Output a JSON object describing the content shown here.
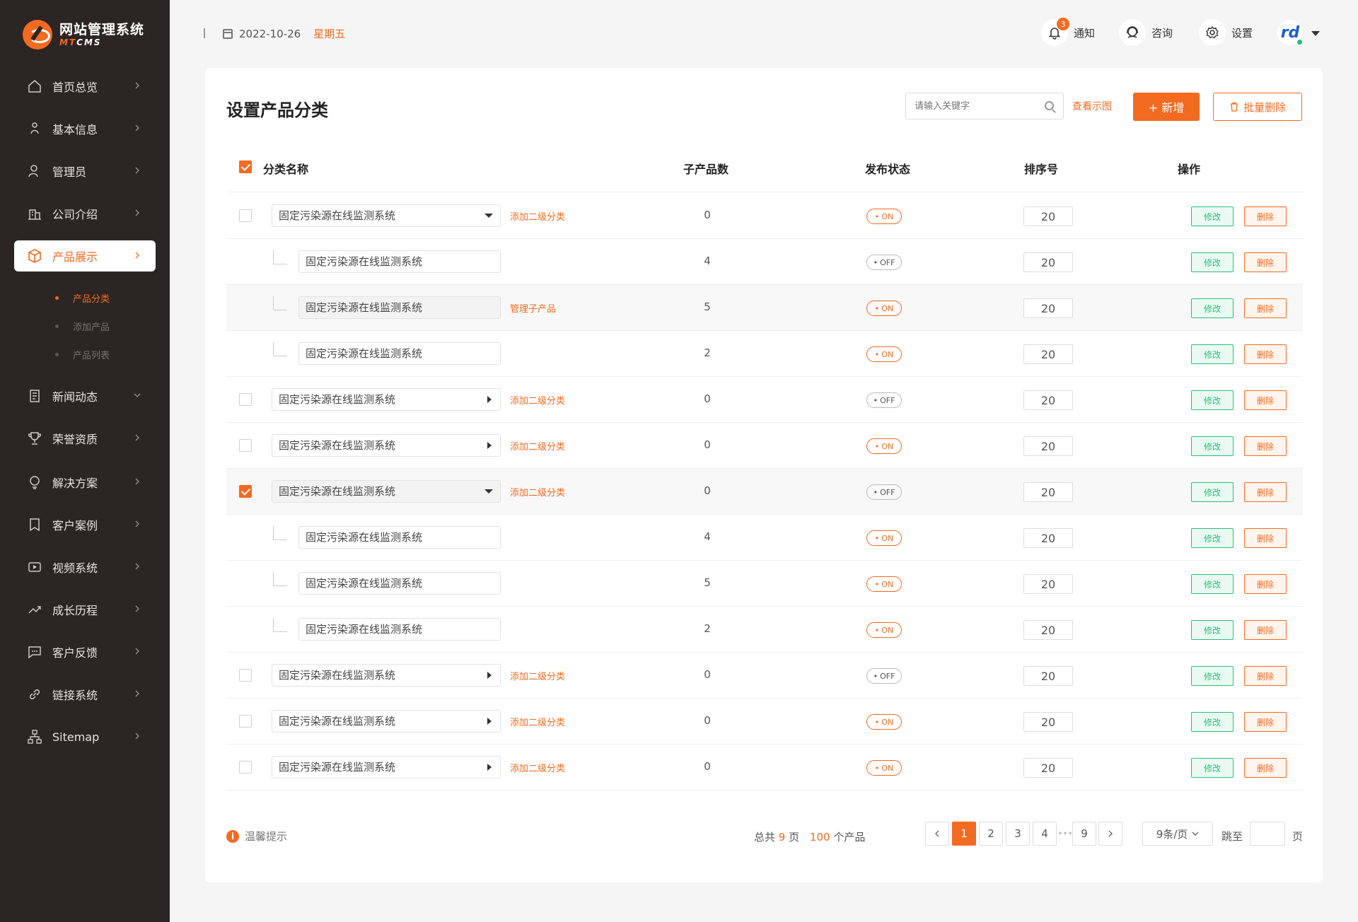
{
  "brand": {
    "title": "网站管理系统",
    "sub_a": "MT",
    "sub_b": "CMS"
  },
  "nav": [
    {
      "label": "首页总览",
      "icon": "home-icon"
    },
    {
      "label": "基本信息",
      "icon": "info-icon"
    },
    {
      "label": "管理员",
      "icon": "admin-icon"
    },
    {
      "label": "公司介绍",
      "icon": "building-icon"
    },
    {
      "label": "产品展示",
      "icon": "box-icon",
      "active": true
    },
    {
      "label": "新闻动态",
      "icon": "news-icon",
      "expanded": true
    },
    {
      "label": "荣誉资质",
      "icon": "trophy-icon"
    },
    {
      "label": "解决方案",
      "icon": "bulb-icon"
    },
    {
      "label": "客户案例",
      "icon": "bookmark-icon"
    },
    {
      "label": "视频系统",
      "icon": "video-icon"
    },
    {
      "label": "成长历程",
      "icon": "trend-icon"
    },
    {
      "label": "客户反馈",
      "icon": "message-icon"
    },
    {
      "label": "链接系统",
      "icon": "link-icon"
    },
    {
      "label": "Sitemap",
      "icon": "sitemap-icon"
    }
  ],
  "subnav": [
    "产品分类",
    "添加产品",
    "产品列表"
  ],
  "header": {
    "date": "2022-10-26",
    "weekday": "星期五",
    "notify_label": "通知",
    "notify_count": "3",
    "consult_label": "咨询",
    "settings_label": "设置",
    "avatar_text": "rd"
  },
  "page": {
    "title": "设置产品分类",
    "search_placeholder": "请输入关键字",
    "view_link": "查看示图",
    "add_label": "+ 新增",
    "bulk_delete_label": "批量删除"
  },
  "table": {
    "columns": [
      "分类名称",
      "子产品数",
      "发布状态",
      "排序号",
      "操作"
    ],
    "edit_label": "修改",
    "delete_label": "删除",
    "rows": [
      {
        "level": 1,
        "name": "固定污染源在线监测系统",
        "arrow": "down",
        "link": "添加二级分类",
        "count": "0",
        "status": "ON",
        "sort": "20",
        "checked": false
      },
      {
        "level": 2,
        "name": "固定污染源在线监测系统",
        "link": "",
        "count": "4",
        "status": "OFF",
        "sort": "20"
      },
      {
        "level": 2,
        "name": "固定污染源在线监测系统",
        "link": "管理子产品",
        "count": "5",
        "status": "ON",
        "sort": "20",
        "shade": true
      },
      {
        "level": 2,
        "name": "固定污染源在线监测系统",
        "link": "",
        "count": "2",
        "status": "ON",
        "sort": "20"
      },
      {
        "level": 1,
        "name": "固定污染源在线监测系统",
        "arrow": "right",
        "link": "添加二级分类",
        "count": "0",
        "status": "OFF",
        "sort": "20",
        "checked": false
      },
      {
        "level": 1,
        "name": "固定污染源在线监测系统",
        "arrow": "right",
        "link": "添加二级分类",
        "count": "0",
        "status": "ON",
        "sort": "20",
        "checked": false
      },
      {
        "level": 1,
        "name": "固定污染源在线监测系统",
        "arrow": "down",
        "link": "添加二级分类",
        "count": "0",
        "status": "OFF",
        "sort": "20",
        "checked": true,
        "shade": true
      },
      {
        "level": 2,
        "name": "固定污染源在线监测系统",
        "link": "",
        "count": "4",
        "status": "ON",
        "sort": "20"
      },
      {
        "level": 2,
        "name": "固定污染源在线监测系统",
        "link": "",
        "count": "5",
        "status": "ON",
        "sort": "20"
      },
      {
        "level": 2,
        "name": "固定污染源在线监测系统",
        "link": "",
        "count": "2",
        "status": "ON",
        "sort": "20"
      },
      {
        "level": 1,
        "name": "固定污染源在线监测系统",
        "arrow": "right",
        "link": "添加二级分类",
        "count": "0",
        "status": "OFF",
        "sort": "20",
        "checked": false
      },
      {
        "level": 1,
        "name": "固定污染源在线监测系统",
        "arrow": "right",
        "link": "添加二级分类",
        "count": "0",
        "status": "ON",
        "sort": "20",
        "checked": false
      },
      {
        "level": 1,
        "name": "固定污染源在线监测系统",
        "arrow": "right",
        "link": "添加二级分类",
        "count": "0",
        "status": "ON",
        "sort": "20",
        "checked": false
      }
    ]
  },
  "footer": {
    "tip": "温馨提示",
    "total_prefix": "总共",
    "total_pages": "9",
    "total_pages_unit": "页",
    "total_items": "100",
    "total_items_unit": "个产品",
    "pages": [
      "1",
      "2",
      "3",
      "4",
      "•••",
      "9"
    ],
    "current_page": "1",
    "page_size": "9条/页",
    "jump_label": "跳至",
    "jump_unit": "页"
  },
  "colors": {
    "accent": "#f26b21",
    "success": "#29c07a",
    "sidebar": "#2b2523"
  }
}
